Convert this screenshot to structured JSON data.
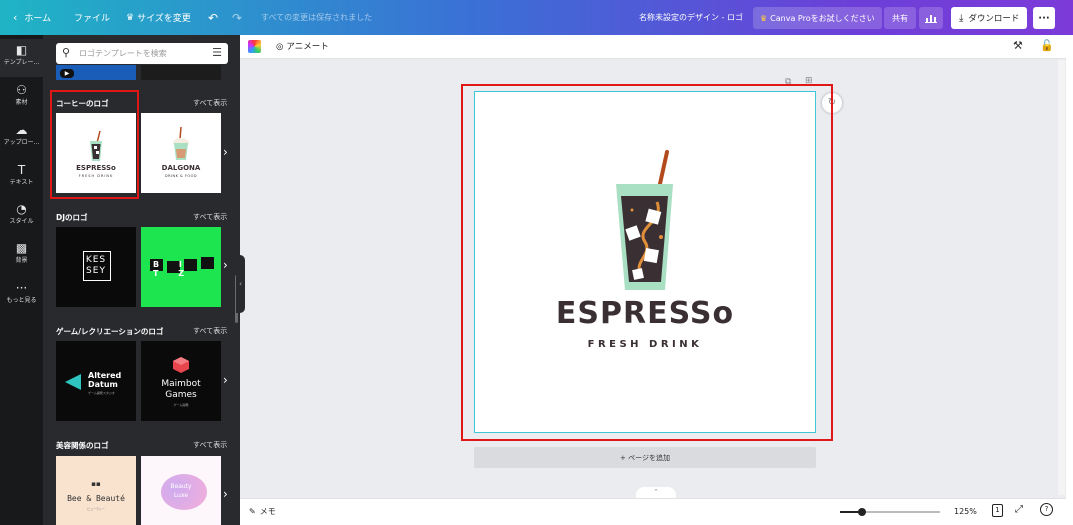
{
  "topbar": {
    "back_icon": "chevron-left-icon",
    "home": "ホーム",
    "file": "ファイル",
    "resize": "サイズを変更",
    "undo_icon": "undo-icon",
    "redo_icon": "redo-icon",
    "save_status": "すべての変更は保存されました",
    "design_title": "名称未設定のデザイン - ロゴ",
    "pro_label": "Canva Proをお試しください",
    "share": "共有",
    "chart_icon": "bar-chart-icon",
    "download": "ダウンロード",
    "more": "···"
  },
  "rail": {
    "items": [
      {
        "label": "テンプレー...",
        "icon": "template-icon"
      },
      {
        "label": "素材",
        "icon": "elements-icon"
      },
      {
        "label": "アップロー...",
        "icon": "upload-icon"
      },
      {
        "label": "テキスト",
        "icon": "text-icon"
      },
      {
        "label": "スタイル",
        "icon": "palette-icon"
      },
      {
        "label": "背景",
        "icon": "background-icon"
      },
      {
        "label": "もっと見る",
        "icon": "more-icon"
      }
    ]
  },
  "panel": {
    "search_placeholder": "ロゴテンプレートを検索",
    "see_all": "すべて表示",
    "sections": [
      {
        "title": "コーヒーのロゴ",
        "thumbs": [
          {
            "line1": "ESPRESSo",
            "line2": "FRESH DRINK"
          },
          {
            "line1": "DALGONA",
            "line2": "DRINK & FOOD"
          }
        ]
      },
      {
        "title": "DJのロゴ",
        "thumbs": [
          {
            "line1": "KES",
            "line2": "SEY"
          },
          {
            "line1": "B I T Z",
            "line2": ""
          }
        ]
      },
      {
        "title": "ゲーム/レクリエーションのロゴ",
        "thumbs": [
          {
            "line1": "Altered",
            "line2": "Datum",
            "line3": "ゲーム開発スタジオ"
          },
          {
            "line1": "Maimbot",
            "line2": "Games",
            "line3": "ゲーム開発"
          }
        ]
      },
      {
        "title": "美容関係のロゴ",
        "thumbs": [
          {
            "line1": "Bee & Beauté",
            "line2": "ビューティー"
          },
          {
            "line1": "Beauty",
            "line2": "Luxe"
          }
        ]
      }
    ]
  },
  "editor": {
    "animate": "アニメート",
    "logo_title": "ESPRESSo",
    "logo_subtitle": "FRESH DRINK",
    "add_page": "+ ページを追加",
    "notes": "メモ",
    "zoom": "125%",
    "page_num": "1",
    "help": "?"
  },
  "colors": {
    "accent_red": "#e01717",
    "selection": "#3fc7d8",
    "espresso_text": "#3a2f32",
    "dj_green": "#1de54f",
    "game_teal": "#2ec4c0",
    "game_red": "#e8464f"
  }
}
